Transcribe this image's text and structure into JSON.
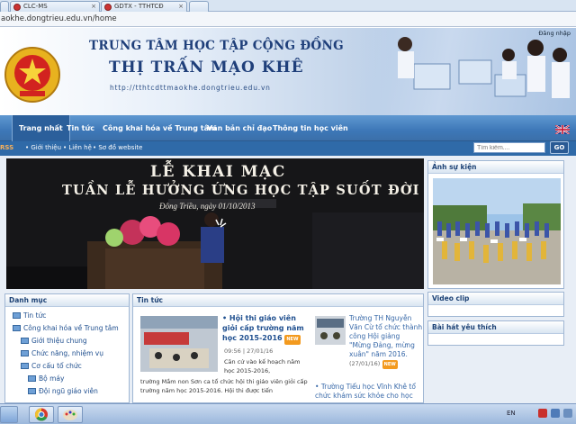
{
  "browser": {
    "tabs": [
      {
        "label": "..."
      },
      {
        "label": "CLC-MS"
      },
      {
        "label": "GDTX - TTHTCĐ"
      }
    ],
    "address": "aokhe.dongtrieu.edu.vn/home"
  },
  "header": {
    "login": "Đăng nhập",
    "title_line1": "TRUNG TÂM HỌC TẬP CỘNG ĐỒNG",
    "title_line2": "THỊ TRẤN MẠO KHÊ",
    "url": "http://tthtcdttmaokhe.dongtrieu.edu.vn"
  },
  "menu": {
    "items": [
      "Trang nhất",
      "Tin tức",
      "Công khai hóa về Trung tâm",
      "Văn bản chỉ đạo",
      "Thông tin học viên"
    ]
  },
  "subbar": {
    "rss": "RSS",
    "links": [
      "Giới thiệu",
      "Liên hệ",
      "Sơ đồ website"
    ],
    "search_placeholder": "Tìm kiếm....",
    "go": "GO"
  },
  "slideshow": {
    "line1": "LỄ KHAI MẠC",
    "line2": "TUẦN LỄ HƯỞNG ỨNG HỌC TẬP SUỐT ĐỜI",
    "line3": "Đông Triều, ngày 01/10/2013"
  },
  "sidebar": {
    "heading": "Danh mục",
    "items": [
      {
        "label": "Tin tức",
        "level": 0
      },
      {
        "label": "Công khai hóa về Trung tâm",
        "level": 0
      },
      {
        "label": "Giới thiệu chung",
        "level": 1
      },
      {
        "label": "Chức năng, nhiệm vụ",
        "level": 1
      },
      {
        "label": "Cơ cấu tổ chức",
        "level": 1
      },
      {
        "label": "Bộ máy",
        "level": 2
      },
      {
        "label": "Đội ngũ giáo viên",
        "level": 2
      }
    ]
  },
  "news": {
    "heading": "Tin tức",
    "main": {
      "title": "Hội thi giáo viên giỏi cấp trường năm học 2015-2016",
      "new_badge": "NEW",
      "time": "09:56",
      "sep": "|",
      "date": "27/01/16",
      "summary1": "Căn cứ vào kế hoạch năm học 2015-2016,",
      "summary2": "trường Mầm non Sơn ca tổ chức hội thi giáo viên giỏi cấp trường năm học 2015-2016. Hội thi được tiến"
    },
    "side": {
      "text1": "Trường TH Nguyễn Văn Cừ tổ chức thành công Hội giảng \"Mừng Đảng, mừng xuân\" năm 2016.",
      "date1": "(27/01/16)",
      "badge1": "NEW",
      "link2": "Trường Tiểu học Vĩnh Khê tổ chức khám sức khỏe cho học"
    }
  },
  "right": {
    "events_heading": "Ảnh sự kiện",
    "video_heading": "Video clip",
    "song_heading": "Bài hát yêu thích"
  },
  "taskbar": {
    "lang": "EN"
  },
  "colors": {
    "menu_blue": "#3d78b8",
    "title_blue": "#1f3f7a",
    "badge_orange": "#f39a1e"
  }
}
